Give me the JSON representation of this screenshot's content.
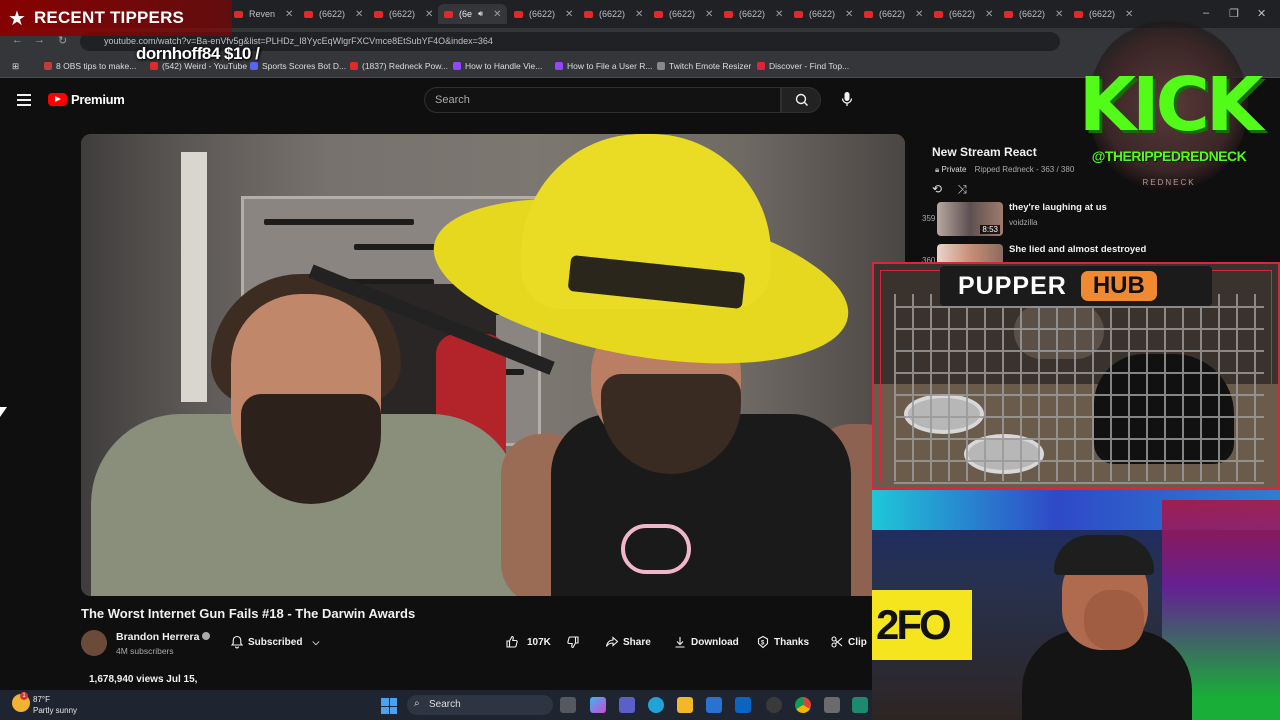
{
  "browser": {
    "tabs": [
      {
        "label": "Reven",
        "active": false
      },
      {
        "label": "(6622)",
        "active": false
      },
      {
        "label": "(6622)",
        "active": false
      },
      {
        "label": "(6e",
        "active": true
      },
      {
        "label": "(6622)",
        "active": false
      },
      {
        "label": "(6622)",
        "active": false
      },
      {
        "label": "(6622)",
        "active": false
      },
      {
        "label": "(6622)",
        "active": false
      },
      {
        "label": "(6622)",
        "active": false
      },
      {
        "label": "(6622)",
        "active": false
      },
      {
        "label": "(6622)",
        "active": false
      },
      {
        "label": "(6622)",
        "active": false
      },
      {
        "label": "(6622)",
        "active": false
      }
    ],
    "url": "youtube.com/watch?v=Ba-enVfv5g&list=PLHDz_I8YycEqWlgrFXCVmce8EtSubYF4O&index=364",
    "bookmarks": [
      {
        "label": "8 OBS tips to make...",
        "color": "#c43b3b"
      },
      {
        "label": "(542) Weird - YouTube",
        "color": "#e02a2a"
      },
      {
        "label": "Sports Scores Bot D...",
        "color": "#5865f2"
      },
      {
        "label": "(1837) Redneck Pow...",
        "color": "#e02a2a"
      },
      {
        "label": "How to Handle Vie...",
        "color": "#9146ff"
      },
      {
        "label": "How to File a User R...",
        "color": "#9146ff"
      },
      {
        "label": "Twitch Emote Resizer",
        "color": "#888888"
      },
      {
        "label": "Discover - Find Top...",
        "color": "#e0233c"
      }
    ]
  },
  "youtube": {
    "brand": "Premium",
    "search_placeholder": "Search",
    "video_title": "The Worst Internet Gun Fails #18 - The Darwin Awards",
    "channel_name": "Brandon Herrera",
    "subscribers": "4M subscribers",
    "subscribe_state": "Subscribed",
    "likes": "107K",
    "share": "Share",
    "download": "Download",
    "thanks": "Thanks",
    "clip": "Clip",
    "views_date": "1,678,940 views  Jul 15,"
  },
  "playlist": {
    "title": "New Stream React",
    "privacy": "Private",
    "owner_position": "Ripped Redneck - 363 / 380",
    "items": [
      {
        "index": "359",
        "title": "they're laughing at us",
        "channel": "voidzilla",
        "duration": "8:53"
      },
      {
        "index": "360",
        "title": "She lied and almost destroyed",
        "channel": "",
        "duration": ""
      }
    ]
  },
  "overlays": {
    "recent_tippers": "RECENT TIPPERS",
    "tipper_entry": "dornhoff84 $10 /",
    "kick_word": "KICK",
    "kick_handle": "@THERIPPEDREDNECK",
    "kick_sub": "REDNECK",
    "pupper_left": "PUPPER",
    "pupper_right": "HUB",
    "sign_text": "2FO"
  },
  "taskbar": {
    "temperature": "87°F",
    "condition": "Partly sunny",
    "search": "Search",
    "notification_count": "1"
  }
}
